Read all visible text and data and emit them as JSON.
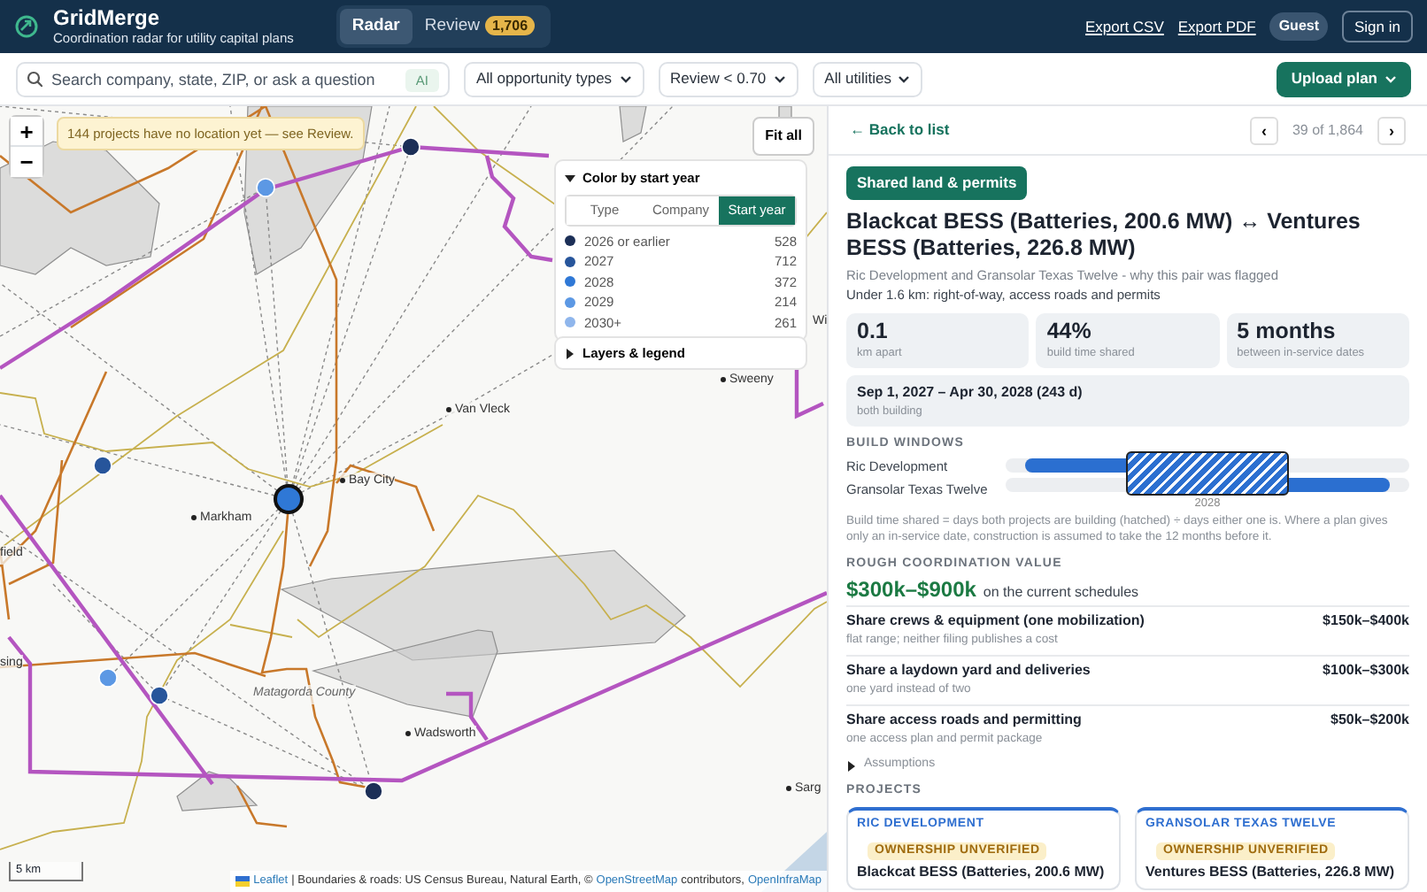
{
  "app": {
    "name": "GridMerge",
    "tagline": "Coordination radar for utility capital plans"
  },
  "nav_tabs": [
    {
      "label": "Radar",
      "selected": true
    },
    {
      "label": "Review",
      "selected": false,
      "badge": "1,706"
    }
  ],
  "header_links": [
    "Export CSV",
    "Export PDF"
  ],
  "user": {
    "role": "Guest",
    "sign_in": "Sign in"
  },
  "toolbar": {
    "search": {
      "placeholder": "Search company, state, ZIP, or ask a question",
      "ai": "AI"
    },
    "filters": [
      "All opportunity types",
      "Review < 0.70",
      "All utilities"
    ],
    "upload": "Upload plan"
  },
  "map": {
    "zoom_in": "+",
    "zoom_out": "−",
    "notice": "144 projects have no location yet — see Review.",
    "fit_all": "Fit all",
    "legend": {
      "title": "Color by start year",
      "expanded": true,
      "tabs": [
        {
          "label": "Type",
          "selected": false
        },
        {
          "label": "Company",
          "selected": false
        },
        {
          "label": "Start year",
          "selected": true
        }
      ],
      "items": [
        {
          "label": "2026 or earlier",
          "count": "528",
          "color": "#1c2f57"
        },
        {
          "label": "2027",
          "count": "712",
          "color": "#27559b"
        },
        {
          "label": "2028",
          "count": "372",
          "color": "#2f78d6"
        },
        {
          "label": "2029",
          "count": "214",
          "color": "#5c98e4"
        },
        {
          "label": "2030+",
          "count": "261",
          "color": "#8fb6ec"
        }
      ]
    },
    "layers": {
      "title": "Layers & legend",
      "expanded": false
    },
    "places": [
      {
        "name": "Wi"
      },
      {
        "name": "Sweeny"
      },
      {
        "name": "Van Vleck"
      },
      {
        "name": "Bay City"
      },
      {
        "name": "Markham"
      },
      {
        "name": "field"
      },
      {
        "name": "sing"
      },
      {
        "name": "Matagorda County"
      },
      {
        "name": "Wadsworth"
      },
      {
        "name": "Sarg"
      }
    ],
    "scale": "5 km",
    "attribution": [
      {
        "text": "Leaflet",
        "link": true
      },
      {
        "text": "| Boundaries & roads: US Census Bureau, Natural Earth, ©",
        "link": false
      },
      {
        "text": "OpenStreetMap",
        "link": true
      },
      {
        "text": "contributors,",
        "link": false
      },
      {
        "text": "OpenInfraMap",
        "link": true
      }
    ]
  },
  "detail": {
    "back": "← Back to list",
    "pager": {
      "prev": "‹",
      "position": "39 of 1,864",
      "next": "›"
    },
    "tag": "Shared land & permits",
    "title": "Blackcat BESS (Batteries, 200.6 MW) ↔ Ventures BESS (Batteries, 226.8 MW)",
    "subtitle": "Ric Development and Gransolar Texas Twelve - why this pair was flagged",
    "summary": "Under 1.6 km: right-of-way, access roads and permits",
    "stats": [
      {
        "value": "0.1",
        "label": "km apart"
      },
      {
        "value": "44%",
        "label": "build time shared"
      },
      {
        "value": "5 months",
        "label": "between in-service dates"
      }
    ],
    "overlap": {
      "value": "Sep 1, 2027 – Apr 30, 2028 (243 d)",
      "label": "both building"
    },
    "build_windows": {
      "heading": "BUILD WINDOWS",
      "rows": [
        {
          "label": "Ric Development"
        },
        {
          "label": "Gransolar Texas Twelve"
        }
      ],
      "tick": "2028",
      "note": "Build time shared = days both projects are building (hatched) ÷ days either one is. Where a plan gives only an in-service date, construction is assumed to take the 12 months before it."
    },
    "value": {
      "heading": "ROUGH COORDINATION VALUE",
      "range": "$300k–$900k",
      "range_note": "on the current schedules",
      "items": [
        {
          "title": "Share crews & equipment (one mobilization)",
          "amount": "$150k–$400k",
          "note": "flat range; neither filing publishes a cost"
        },
        {
          "title": "Share a laydown yard and deliveries",
          "amount": "$100k–$300k",
          "note": "one yard instead of two"
        },
        {
          "title": "Share access roads and permitting",
          "amount": "$50k–$200k",
          "note": "one access plan and permit package"
        }
      ],
      "assumptions": {
        "label": "Assumptions",
        "expanded": false
      }
    },
    "projects": {
      "heading": "PROJECTS",
      "cards": [
        {
          "company": "RIC DEVELOPMENT",
          "flag": "OWNERSHIP UNVERIFIED",
          "name": "Blackcat BESS (Batteries, 200.6 MW)"
        },
        {
          "company": "GRANSOLAR TEXAS TWELVE",
          "flag": "OWNERSHIP UNVERIFIED",
          "name": "Ventures BESS (Batteries, 226.8 MW)"
        }
      ]
    }
  }
}
